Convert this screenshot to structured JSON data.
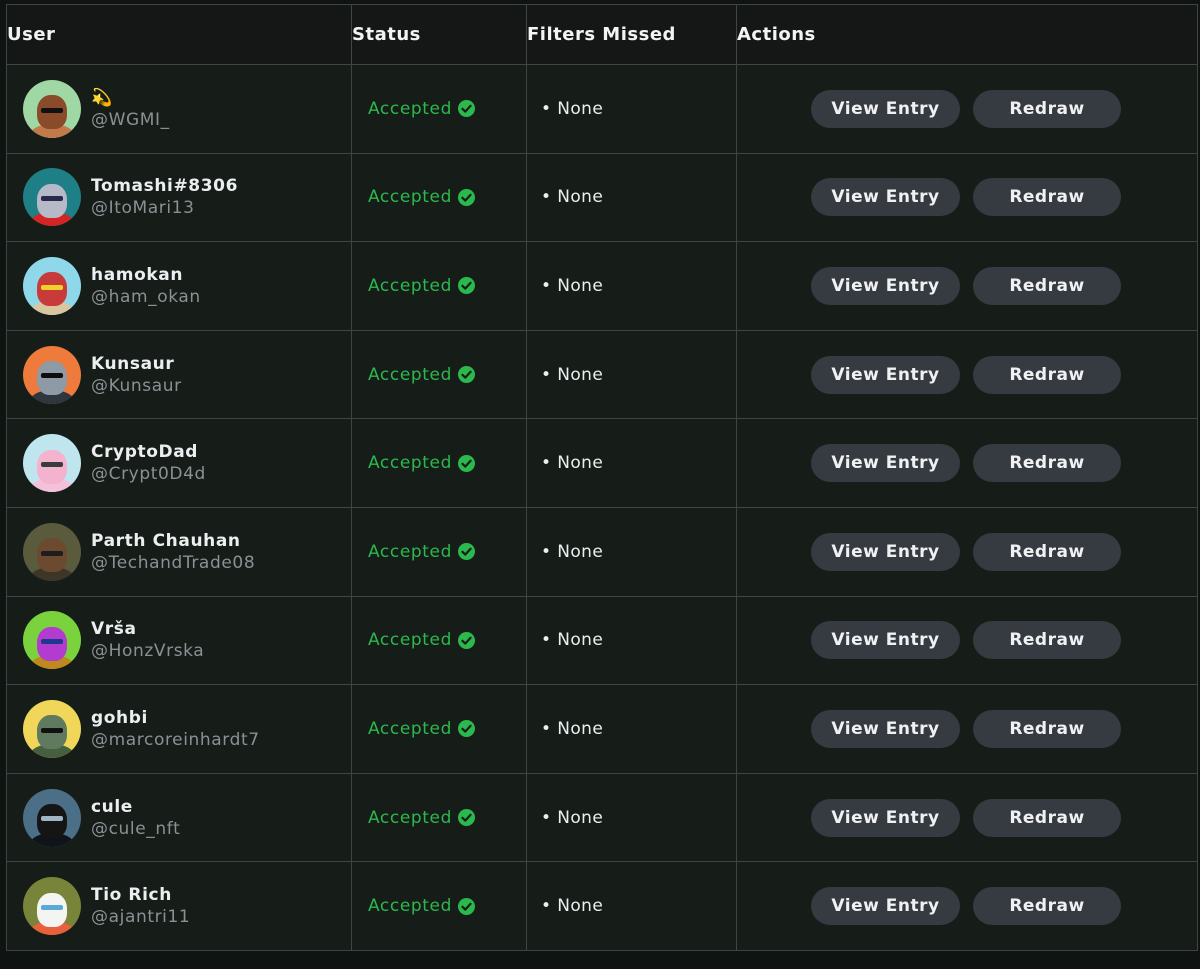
{
  "table": {
    "headers": [
      "User",
      "Status",
      "Filters Missed",
      "Actions"
    ],
    "rows": [
      {
        "display_name": "💫",
        "handle": "@WGMI_",
        "status": "Accepted",
        "filters_missed": "• None",
        "view_label": "View Entry",
        "redraw_label": "Redraw",
        "avatar": {
          "bg": "#9fd8a4",
          "face": "#8a4b2a",
          "body": "#c27a4a",
          "eyes": "#111111"
        }
      },
      {
        "display_name": "Tomashi#8306",
        "handle": "@ItoMari13",
        "status": "Accepted",
        "filters_missed": "• None",
        "view_label": "View Entry",
        "redraw_label": "Redraw",
        "avatar": {
          "bg": "#1e7f86",
          "face": "#b5b9c8",
          "body": "#d42424",
          "eyes": "#2a2a4a"
        }
      },
      {
        "display_name": "hamokan",
        "handle": "@ham_okan",
        "status": "Accepted",
        "filters_missed": "• None",
        "view_label": "View Entry",
        "redraw_label": "Redraw",
        "avatar": {
          "bg": "#8fd8ea",
          "face": "#c83b3b",
          "body": "#d9c7a0",
          "eyes": "#f2d12b"
        }
      },
      {
        "display_name": "Kunsaur",
        "handle": "@Kunsaur",
        "status": "Accepted",
        "filters_missed": "• None",
        "view_label": "View Entry",
        "redraw_label": "Redraw",
        "avatar": {
          "bg": "#ee7b3c",
          "face": "#8e9aa6",
          "body": "#2e3640",
          "eyes": "#0d0d0d"
        }
      },
      {
        "display_name": "CryptoDad",
        "handle": "@Crypt0D4d",
        "status": "Accepted",
        "filters_missed": "• None",
        "view_label": "View Entry",
        "redraw_label": "Redraw",
        "avatar": {
          "bg": "#bfe6ef",
          "face": "#f3b3cf",
          "body": "#f5c1d8",
          "eyes": "#3b3b3b"
        }
      },
      {
        "display_name": "Parth Chauhan",
        "handle": "@TechandTrade08",
        "status": "Accepted",
        "filters_missed": "• None",
        "view_label": "View Entry",
        "redraw_label": "Redraw",
        "avatar": {
          "bg": "#5a5a3c",
          "face": "#6b4a2f",
          "body": "#3d3526",
          "eyes": "#1e1e1e"
        }
      },
      {
        "display_name": "Vrša",
        "handle": "@HonzVrska",
        "status": "Accepted",
        "filters_missed": "• None",
        "view_label": "View Entry",
        "redraw_label": "Redraw",
        "avatar": {
          "bg": "#7ad33c",
          "face": "#b23bd0",
          "body": "#c0891e",
          "eyes": "#1f3a8a"
        }
      },
      {
        "display_name": "gohbi",
        "handle": "@marcoreinhardt7",
        "status": "Accepted",
        "filters_missed": "• None",
        "view_label": "View Entry",
        "redraw_label": "Redraw",
        "avatar": {
          "bg": "#f0d75a",
          "face": "#5f7a5f",
          "body": "#46603f",
          "eyes": "#111111"
        }
      },
      {
        "display_name": "cule",
        "handle": "@cule_nft",
        "status": "Accepted",
        "filters_missed": "• None",
        "view_label": "View Entry",
        "redraw_label": "Redraw",
        "avatar": {
          "bg": "#4a6f86",
          "face": "#151515",
          "body": "#101418",
          "eyes": "#9fb4c4"
        }
      },
      {
        "display_name": "Tio Rich",
        "handle": "@ajantri11",
        "status": "Accepted",
        "filters_missed": "• None",
        "view_label": "View Entry",
        "redraw_label": "Redraw",
        "avatar": {
          "bg": "#78843a",
          "face": "#f4f4f2",
          "body": "#e8613a",
          "eyes": "#5aa9d6"
        }
      }
    ]
  },
  "colors": {
    "accepted": "#2bb84c",
    "button_bg": "#363a41",
    "row_bg": "#161d19",
    "header_bg": "#151616",
    "border": "#3d4545"
  },
  "icons": {
    "status": "check-circle-icon"
  }
}
